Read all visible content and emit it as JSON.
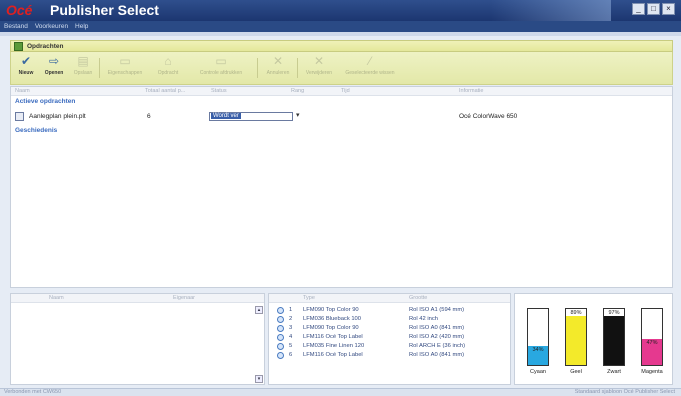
{
  "window": {
    "brand": "Océ",
    "title": "Publisher Select"
  },
  "menu": {
    "items": [
      "Bestand",
      "Voorkeuren",
      "Help"
    ]
  },
  "panel": {
    "title": "Opdrachten"
  },
  "toolbar": {
    "buttons": [
      {
        "label": "Nieuw",
        "icon": "check-icon",
        "state": "active"
      },
      {
        "label": "Openen",
        "icon": "folder-open-icon",
        "state": "active"
      },
      {
        "label": "Opslaan",
        "icon": "save-icon",
        "state": "disabled"
      },
      {
        "label": "Eigenschappen",
        "icon": "properties-icon",
        "state": "disabled"
      },
      {
        "label": "Opdracht",
        "icon": "job-icon",
        "state": "disabled"
      },
      {
        "label": "Controle afdrukken",
        "icon": "print-check-icon",
        "state": "disabled"
      },
      {
        "label": "Annuleren",
        "icon": "x-icon",
        "state": "disabled"
      },
      {
        "label": "Verwijderen",
        "icon": "x-icon",
        "state": "disabled"
      },
      {
        "label": "Geselecteerde wissen",
        "icon": "clear-icon",
        "state": "disabled"
      }
    ]
  },
  "list": {
    "columns": [
      "Naam",
      "Totaal aantal p...",
      "Status",
      "Rang",
      "Tijd",
      "Informatie"
    ],
    "sections": {
      "active": "Actieve opdrachten",
      "history": "Geschiedenis"
    },
    "rows": [
      {
        "name": "Aanlegplan plein.plt",
        "count": "6",
        "status": "Wordt ver",
        "info": "Océ ColorWave 650"
      }
    ]
  },
  "users": {
    "columns": [
      "Naam",
      "Eigenaar"
    ]
  },
  "media": {
    "columns": [
      "Type",
      "Grootte"
    ],
    "rows": [
      {
        "idx": "1",
        "type": "LFM090 Top Color 90",
        "size": "Rol ISO A1 (594 mm)"
      },
      {
        "idx": "2",
        "type": "LFM036 Blueback 100",
        "size": "Rol 42 inch"
      },
      {
        "idx": "3",
        "type": "LFM090 Top Color 90",
        "size": "Rol ISO A0 (841 mm)"
      },
      {
        "idx": "4",
        "type": "LFM116 Océ Top Label",
        "size": "Rol ISO A2 (420 mm)"
      },
      {
        "idx": "5",
        "type": "LFM035 Fine Linen 120",
        "size": "Rol ARCH E (36 inch)"
      },
      {
        "idx": "6",
        "type": "LFM116 Océ Top Label",
        "size": "Rol ISO A0 (841 mm)"
      }
    ]
  },
  "ink": [
    {
      "name": "Cyaan",
      "percent": 34,
      "label": "34%",
      "color": "#29a8e0"
    },
    {
      "name": "Geel",
      "percent": 89,
      "label": "89%",
      "color": "#f3ea2a"
    },
    {
      "name": "Zwart",
      "percent": 97,
      "label": "97%",
      "color": "#111111"
    },
    {
      "name": "Magenta",
      "percent": 47,
      "label": "47%",
      "color": "#e5398f"
    }
  ],
  "statusbar": {
    "left": "Verbonden met CW650",
    "right": "Standaard sjabloon Océ Publisher Select"
  }
}
